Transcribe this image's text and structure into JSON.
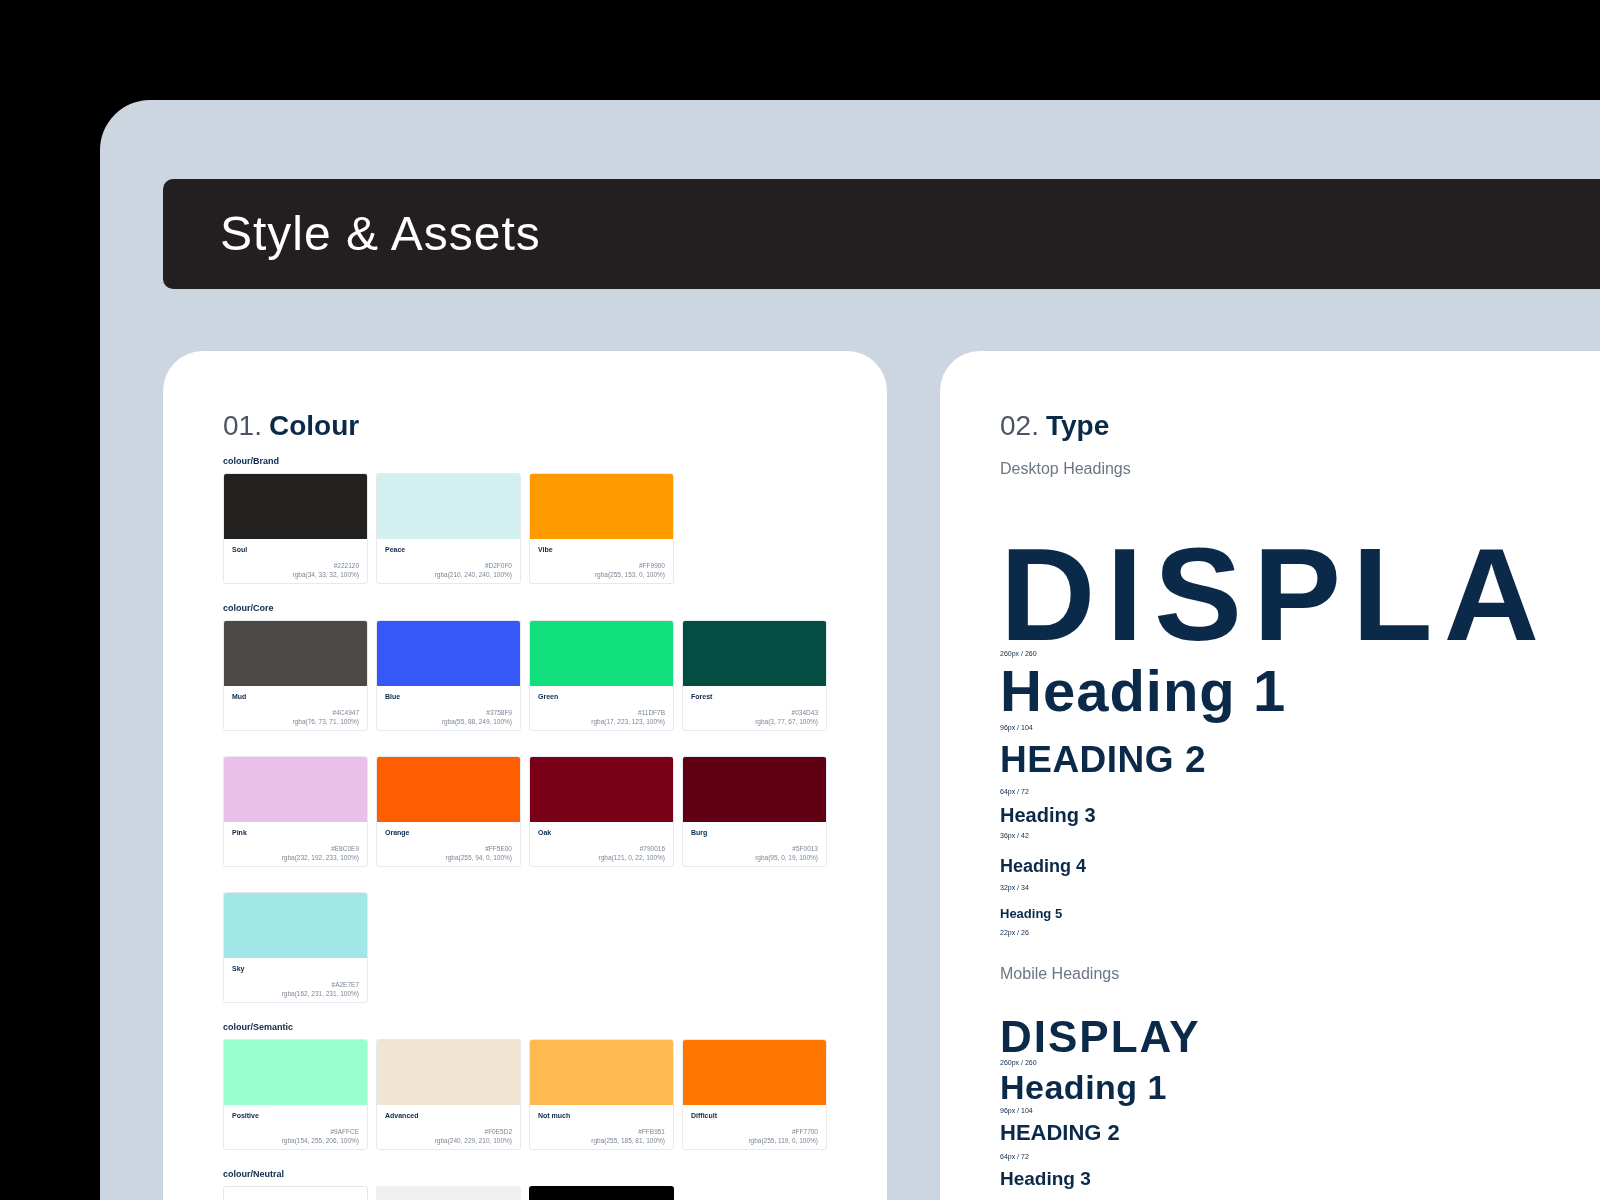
{
  "page": {
    "title": "Style & Assets"
  },
  "colour": {
    "number": "01.",
    "title": "Colour",
    "groups": [
      {
        "label": "colour/Brand",
        "rows": [
          [
            {
              "name": "Soul",
              "color": "#222120",
              "hex": "#222120",
              "rgba": "rgba(34, 33, 32, 100%)"
            },
            {
              "name": "Peace",
              "color": "#d2f0f0",
              "hex": "#D2F0F0",
              "rgba": "rgba(210, 240, 240, 100%)"
            },
            {
              "name": "Vibe",
              "color": "#ff9900",
              "hex": "#FF9900",
              "rgba": "rgba(255, 153, 0, 100%)"
            }
          ]
        ]
      },
      {
        "label": "colour/Core",
        "rows": [
          [
            {
              "name": "Mud",
              "color": "#4c4947",
              "hex": "#4C4947",
              "rgba": "rgba(76, 73, 71, 100%)"
            },
            {
              "name": "Blue",
              "color": "#3758f9",
              "hex": "#3758F9",
              "rgba": "rgba(55, 88, 249, 100%)"
            },
            {
              "name": "Green",
              "color": "#11df7b",
              "hex": "#11DF7B",
              "rgba": "rgba(17, 223, 123, 100%)"
            },
            {
              "name": "Forest",
              "color": "#034d43",
              "hex": "#034D43",
              "rgba": "rgba(3, 77, 67, 100%)"
            }
          ],
          [
            {
              "name": "Pink",
              "color": "#e8c0e9",
              "hex": "#E8C0E9",
              "rgba": "rgba(232, 192, 233, 100%)"
            },
            {
              "name": "Orange",
              "color": "#ff5e00",
              "hex": "#FF5E00",
              "rgba": "rgba(255, 94, 0, 100%)"
            },
            {
              "name": "Oak",
              "color": "#790016",
              "hex": "#790016",
              "rgba": "rgba(121, 0, 22, 100%)"
            },
            {
              "name": "Burg",
              "color": "#5f0013",
              "hex": "#5F0013",
              "rgba": "rgba(95, 0, 19, 100%)"
            }
          ],
          [
            {
              "name": "Sky",
              "color": "#a2e7e7",
              "hex": "#A2E7E7",
              "rgba": "rgba(162, 231, 231, 100%)"
            }
          ]
        ]
      },
      {
        "label": "colour/Semantic",
        "rows": [
          [
            {
              "name": "Positive",
              "color": "#9affce",
              "hex": "#9AFFCE",
              "rgba": "rgba(154, 255, 206, 100%)"
            },
            {
              "name": "Advanced",
              "color": "#f0e5d2",
              "hex": "#F0E5D2",
              "rgba": "rgba(240, 229, 210, 100%)"
            },
            {
              "name": "Not much",
              "color": "#ffb951",
              "hex": "#FFB951",
              "rgba": "rgba(255, 185, 81, 100%)"
            },
            {
              "name": "Difficult",
              "color": "#ff7700",
              "hex": "#FF7700",
              "rgba": "rgba(255, 119, 0, 100%)"
            }
          ]
        ]
      },
      {
        "label": "colour/Neutral",
        "rows": [
          [
            {
              "color": "#ffffff"
            },
            {
              "color": "#eef0f2"
            },
            {
              "color": "#000000"
            }
          ]
        ]
      }
    ]
  },
  "type": {
    "number": "02.",
    "title": "Type",
    "sections": [
      {
        "kind": "desktop",
        "label": "Desktop Headings",
        "styles": [
          {
            "kind": "display",
            "sample": "DISPLA",
            "spec": "260px / 260"
          },
          {
            "kind": "h1",
            "sample": "Heading 1",
            "spec": "96px / 104"
          },
          {
            "kind": "h2",
            "sample": "HEADING 2",
            "spec": "64px / 72"
          },
          {
            "kind": "h3",
            "sample": "Heading 3",
            "spec": "36px / 42"
          },
          {
            "kind": "h4",
            "sample": "Heading 4",
            "spec": "32px / 34"
          },
          {
            "kind": "h5",
            "sample": "Heading 5",
            "spec": "22px / 26"
          }
        ]
      },
      {
        "kind": "mobile",
        "label": "Mobile Headings",
        "styles": [
          {
            "kind": "display",
            "sample": "DISPLAY",
            "spec": "260px / 260"
          },
          {
            "kind": "h1",
            "sample": "Heading 1",
            "spec": "96px / 104"
          },
          {
            "kind": "h2",
            "sample": "HEADING 2",
            "spec": "64px / 72"
          },
          {
            "kind": "h3",
            "sample": "Heading 3"
          }
        ]
      }
    ]
  }
}
